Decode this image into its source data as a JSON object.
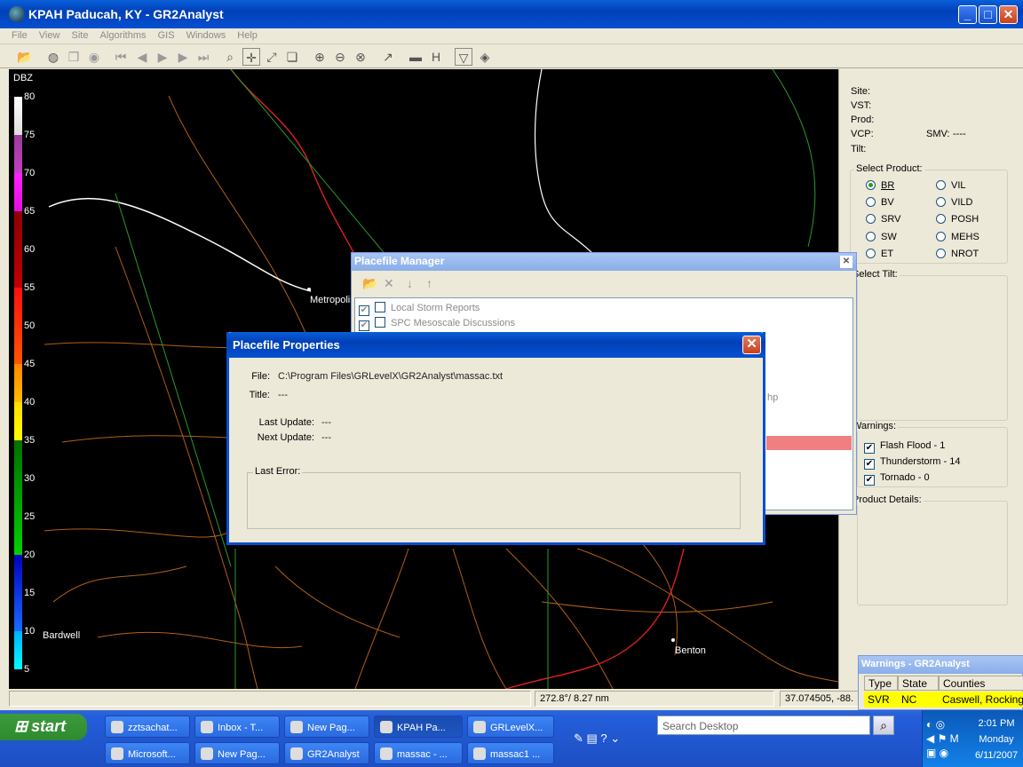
{
  "window": {
    "title": "KPAH Paducah, KY - GR2Analyst"
  },
  "menu": [
    "File",
    "View",
    "Site",
    "Algorithms",
    "GIS",
    "Windows",
    "Help"
  ],
  "dbz": {
    "unit": "DBZ",
    "ticks": [
      "80",
      "75",
      "70",
      "65",
      "60",
      "55",
      "50",
      "45",
      "40",
      "35",
      "30",
      "25",
      "20",
      "15",
      "10",
      "5"
    ]
  },
  "map_labels": {
    "metropolis": "Metropolis",
    "bardwell": "Bardwell",
    "benton": "Benton"
  },
  "right_panel": {
    "site_label": "Site:",
    "vst_label": "VST:",
    "prod_label": "Prod:",
    "vcp_label": "VCP:",
    "smv_label": "SMV:",
    "smv_value": "----",
    "tilt_label": "Tilt:",
    "select_product_title": "Select Product:",
    "products_left": [
      "BR",
      "BV",
      "SRV",
      "SW",
      "ET"
    ],
    "products_right": [
      "VIL",
      "VILD",
      "POSH",
      "MEHS",
      "NROT"
    ],
    "selected_product": "BR",
    "select_tilt_title": "Select Tilt:",
    "warnings_title": "Warnings:",
    "warnings": [
      {
        "label": "Flash Flood - 1",
        "checked": true
      },
      {
        "label": "Thunderstorm - 14",
        "checked": true
      },
      {
        "label": "Tornado - 0",
        "checked": true
      }
    ],
    "product_details_title": "Product Details:"
  },
  "status": {
    "azimuth_range": "272.8°/ 8.27 nm",
    "coords": "37.074505, -88."
  },
  "placefile_manager": {
    "title": "Placefile Manager",
    "rows": [
      {
        "label": "Local Storm Reports"
      },
      {
        "label": "SPC Mesoscale Discussions"
      }
    ],
    "partial_text": "hp"
  },
  "placefile_properties": {
    "title": "Placefile Properties",
    "file_label": "File:",
    "file_value": "C:\\Program Files\\GRLevelX\\GR2Analyst\\massac.txt",
    "title_label": "Title:",
    "title_value": "---",
    "last_update_label": "Last Update:",
    "last_update_value": "---",
    "next_update_label": "Next Update:",
    "next_update_value": "---",
    "last_error_label": "Last Error:"
  },
  "warnings_popup": {
    "title": "Warnings - GR2Analyst",
    "headers": [
      "Type",
      "State",
      "Counties"
    ],
    "row": [
      "SVR",
      "NC",
      "Caswell, Rocking"
    ]
  },
  "taskbar": {
    "start": "start",
    "row1": [
      "zztsachat...",
      "Inbox - T...",
      "New Pag...",
      "KPAH Pa...",
      "GRLevelX..."
    ],
    "row2": [
      "Microsoft...",
      "New Pag...",
      "GR2Analyst",
      "massac - ...",
      "massac1 ..."
    ],
    "search_placeholder": "Search Desktop",
    "time": "2:01 PM",
    "day": "Monday",
    "date": "6/11/2007"
  },
  "colors": {
    "title_blue": "#0a4ed0",
    "highlight_row": "#f08080",
    "warning_yellow": "#ffff00"
  }
}
